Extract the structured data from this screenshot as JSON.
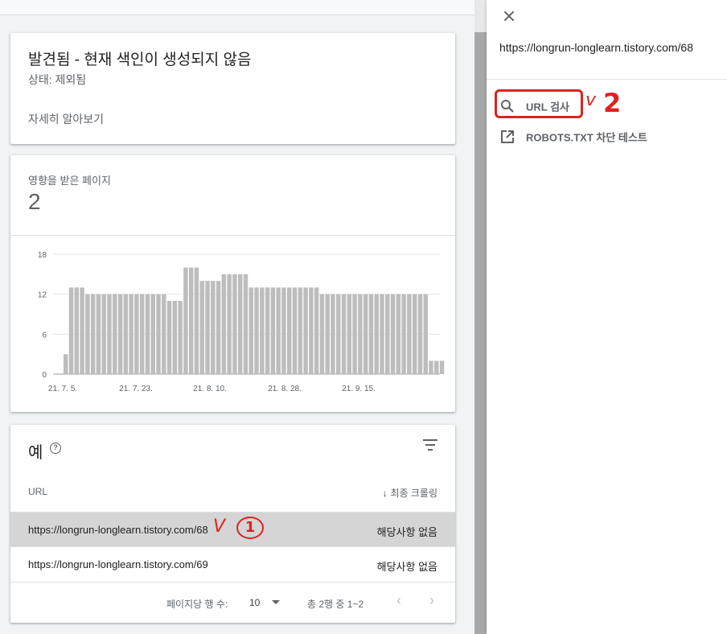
{
  "status_card": {
    "title": "발견됨 - 현재 색인이 생성되지 않음",
    "status": "상태: 제외됨",
    "learn_more": "자세히 알아보기"
  },
  "affected_card": {
    "label": "영향을 받은 페이지",
    "count": "2"
  },
  "chart_data": {
    "type": "bar",
    "title": "",
    "xlabel": "",
    "ylabel": "",
    "yticks": [
      "0",
      "6",
      "12",
      "18"
    ],
    "ylim": [
      0,
      18
    ],
    "grid": true,
    "xtick_labels": [
      "21. 7. 5.",
      "21. 7. 23.",
      "21. 8. 10.",
      "21. 8. 28.",
      "21. 9. 15."
    ],
    "values": [
      3,
      13,
      13,
      13,
      12,
      12,
      12,
      12,
      12,
      12,
      12,
      12,
      12,
      12,
      12,
      12,
      12,
      12,
      12,
      11,
      11,
      11,
      16,
      16,
      16,
      14,
      14,
      14,
      14,
      15,
      15,
      15,
      15,
      15,
      13,
      13,
      13,
      13,
      13,
      13,
      13,
      13,
      13,
      13,
      13,
      13,
      13,
      12,
      12,
      12,
      12,
      12,
      12,
      12,
      12,
      12,
      12,
      12,
      12,
      12,
      12,
      12,
      12,
      12,
      12,
      12,
      12,
      2,
      2,
      2
    ]
  },
  "examples": {
    "title": "예",
    "help_icon": "help-circle-icon",
    "filter_icon": "filter-icon",
    "col_url": "URL",
    "col_crawl": "최종 크롤링",
    "rows": [
      {
        "url": "https://longrun-longlearn.tistory.com/68",
        "crawl": "해당사항 없음"
      },
      {
        "url": "https://longrun-longlearn.tistory.com/69",
        "crawl": "해당사항 없음"
      }
    ],
    "pager": {
      "rows_per_page_label": "페이지당 행 수:",
      "rows_per_page": "10",
      "range": "총 2행 중 1~2",
      "prev": "‹",
      "next": "›"
    }
  },
  "panel": {
    "url": "https://longrun-longlearn.tistory.com/68",
    "actions": [
      {
        "label": "URL 검사",
        "icon": "search-icon"
      },
      {
        "label": "ROBOTS.TXT 차단 테스트",
        "icon": "open-in-new-icon"
      }
    ]
  },
  "annotations": {
    "mark1_check": "V",
    "mark1_num": "1",
    "mark2_check": "v",
    "mark2_num": "2",
    "color": "#e02020"
  }
}
